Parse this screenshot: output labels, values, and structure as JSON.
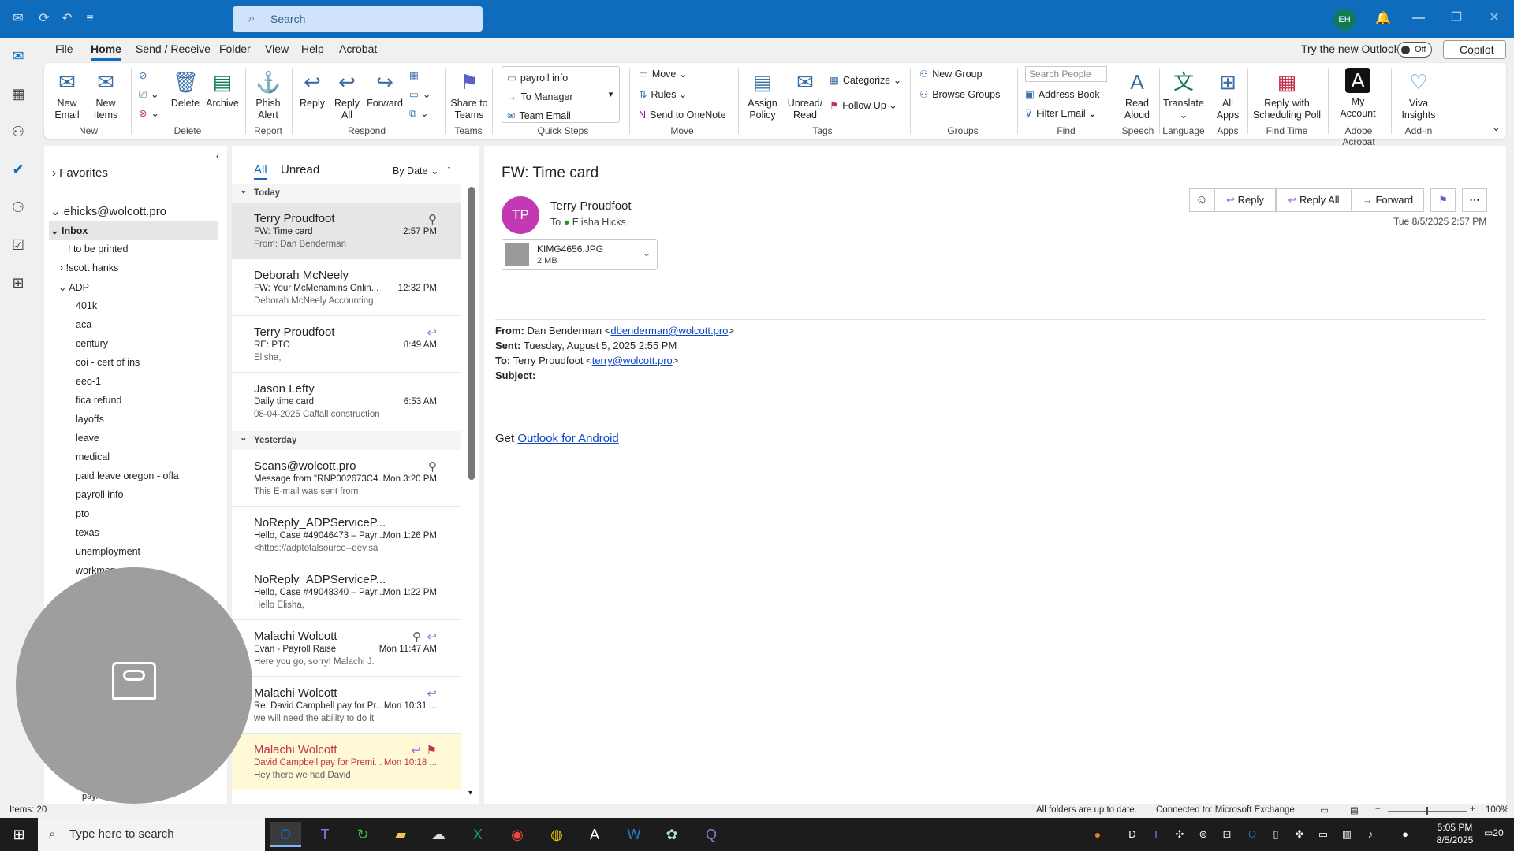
{
  "app": {
    "search_placeholder": "Search",
    "user_initials": "EH"
  },
  "menu": [
    "File",
    "Home",
    "Send / Receive",
    "Folder",
    "View",
    "Help",
    "Acrobat"
  ],
  "topright": {
    "try_new": "Try the new Outlook",
    "toggle": "Off",
    "copilot": "Copilot"
  },
  "ribbon": {
    "new_email": "New\nEmail",
    "new_items": "New\nItems",
    "grp_new": "New",
    "delete": "Delete",
    "archive": "Archive",
    "grp_delete": "Delete",
    "phish": "Phish\nAlert",
    "grp_report": "Report",
    "reply": "Reply",
    "reply_all": "Reply\nAll",
    "forward": "Forward",
    "grp_respond": "Respond",
    "share_teams": "Share to\nTeams",
    "grp_teams": "Teams",
    "qs1": "payroll info",
    "qs2": "To Manager",
    "qs3": "Team Email",
    "grp_qs": "Quick Steps",
    "move": "Move",
    "rules": "Rules",
    "onenote": "Send to OneNote",
    "grp_move": "Move",
    "assign": "Assign\nPolicy",
    "unread": "Unread/\nRead",
    "categorize": "Categorize",
    "followup": "Follow Up",
    "grp_tags": "Tags",
    "new_group": "New Group",
    "browse_groups": "Browse Groups",
    "grp_groups": "Groups",
    "search_people": "Search People",
    "address_book": "Address Book",
    "filter_email": "Filter Email",
    "grp_find": "Find",
    "read_aloud": "Read\nAloud",
    "grp_speech": "Speech",
    "translate": "Translate",
    "grp_language": "Language",
    "all_apps": "All\nApps",
    "grp_apps": "Apps",
    "reply_poll": "Reply with\nScheduling Poll",
    "grp_findtime": "Find Time",
    "my_account": "My\nAccount",
    "grp_acrobat": "Adobe Acrobat",
    "viva": "Viva\nInsights",
    "grp_addin": "Add-in"
  },
  "nav": {
    "favorites": "Favorites",
    "account": "ehicks@wolcott.pro",
    "inbox": "Inbox",
    "folders": [
      "! to be printed",
      "!scott hanks",
      "ADP",
      "401k",
      "aca",
      "century",
      "coi - cert of ins",
      "eeo-1",
      "fica refund",
      "layoffs",
      "leave",
      "medical",
      "paid leave oregon - ofla",
      "payroll info",
      "pto",
      "texas",
      "unemployment",
      "workmen"
    ],
    "bottom": "payroll"
  },
  "list": {
    "tab_all": "All",
    "tab_unread": "Unread",
    "sort": "By Date",
    "today": "Today",
    "yesterday": "Yesterday",
    "messages": [
      {
        "sender": "Terry Proudfoot",
        "subject": "FW: Time card",
        "preview": "From: Dan Benderman",
        "time": "2:57 PM"
      },
      {
        "sender": "Deborah McNeely",
        "subject": "FW: Your McMenamins Onlin...",
        "preview": "Deborah McNeely  Accounting",
        "time": "12:32 PM"
      },
      {
        "sender": "Terry Proudfoot",
        "subject": "RE: PTO",
        "preview": "Elisha,",
        "time": "8:49 AM"
      },
      {
        "sender": "Jason Lefty",
        "subject": "Daily time card",
        "preview": "08-04-2025  Caffall construction",
        "time": "6:53 AM"
      },
      {
        "sender": "Scans@wolcott.pro",
        "subject": "Message from \"RNP002673C4...",
        "preview": "This E-mail was sent from",
        "time": "Mon 3:20 PM"
      },
      {
        "sender": "NoReply_ADPServiceP...",
        "subject": "Hello, Case #49046473 – Payr...",
        "preview": "<https://adptotalsource--dev.sa",
        "time": "Mon 1:26 PM"
      },
      {
        "sender": "NoReply_ADPServiceP...",
        "subject": "Hello, Case #49048340 – Payr...",
        "preview": "Hello Elisha,",
        "time": "Mon 1:22 PM"
      },
      {
        "sender": "Malachi Wolcott",
        "subject": "Evan - Payroll Raise",
        "preview": "Here you go, sorry!  Malachi J.",
        "time": "Mon 11:47 AM"
      },
      {
        "sender": "Malachi Wolcott",
        "subject": "Re: David Campbell pay for Pr...",
        "preview": "we will need the ability to do it",
        "time": "Mon 10:31 ..."
      },
      {
        "sender": "Malachi Wolcott",
        "subject": "David Campbell pay for Premi...",
        "preview": "Hey there we had David",
        "time": "Mon 10:18 ..."
      }
    ]
  },
  "reading": {
    "title": "FW: Time card",
    "initials": "TP",
    "sender": "Terry Proudfoot",
    "to_label": "To",
    "to": "Elisha Hicks",
    "btn_reply": "Reply",
    "btn_reply_all": "Reply All",
    "btn_forward": "Forward",
    "datetime": "Tue 8/5/2025 2:57 PM",
    "attachment_name": "KIMG4656.JPG",
    "attachment_size": "2 MB",
    "from_label": "From:",
    "from_name": "Dan Benderman <",
    "from_email": "dbenderman@wolcott.pro",
    "sent_label": "Sent:",
    "sent": "Tuesday, August 5, 2025 2:55 PM",
    "to2_label": "To:",
    "to2_name": "Terry Proudfoot <",
    "to2_email": "terry@wolcott.pro",
    "subject_label": "Subject:",
    "get": "Get ",
    "get_link": "Outlook for Android",
    "gt": ">"
  },
  "status": {
    "items": "Items: 20",
    "sync": "All folders are up to date.",
    "connected": "Connected to: Microsoft Exchange",
    "zoom": "100%"
  },
  "taskbar": {
    "search": "Type here to search",
    "time": "5:05 PM",
    "date": "8/5/2025",
    "notif": "20"
  }
}
